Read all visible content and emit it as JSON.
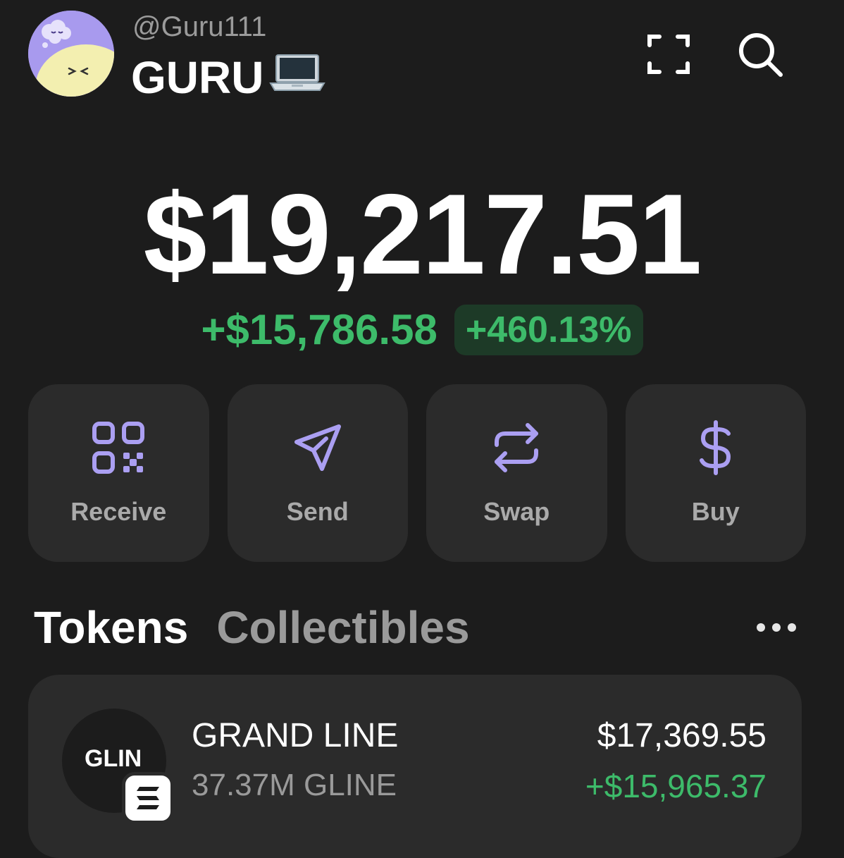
{
  "header": {
    "username": "@Guru111",
    "display_name": "GURU",
    "display_name_emoji": "laptop-emoji"
  },
  "balance": {
    "total": "$19,217.51",
    "change_amount": "+$15,786.58",
    "change_percent": "+460.13%"
  },
  "actions": [
    {
      "label": "Receive",
      "icon": "qr-code-icon"
    },
    {
      "label": "Send",
      "icon": "send-icon"
    },
    {
      "label": "Swap",
      "icon": "swap-icon"
    },
    {
      "label": "Buy",
      "icon": "dollar-icon"
    }
  ],
  "tabs": [
    {
      "label": "Tokens",
      "active": true
    },
    {
      "label": "Collectibles",
      "active": false
    }
  ],
  "tokens": [
    {
      "logo_text": "GLIN",
      "name": "GRAND LINE",
      "amount": "37.37M GLINE",
      "value": "$17,369.55",
      "change": "+$15,965.37",
      "chain_icon": "solana-icon"
    }
  ],
  "colors": {
    "background": "#1c1c1c",
    "card": "#2b2b2b",
    "accent_purple": "#ab9ff2",
    "positive_green": "#3dbb6a"
  }
}
